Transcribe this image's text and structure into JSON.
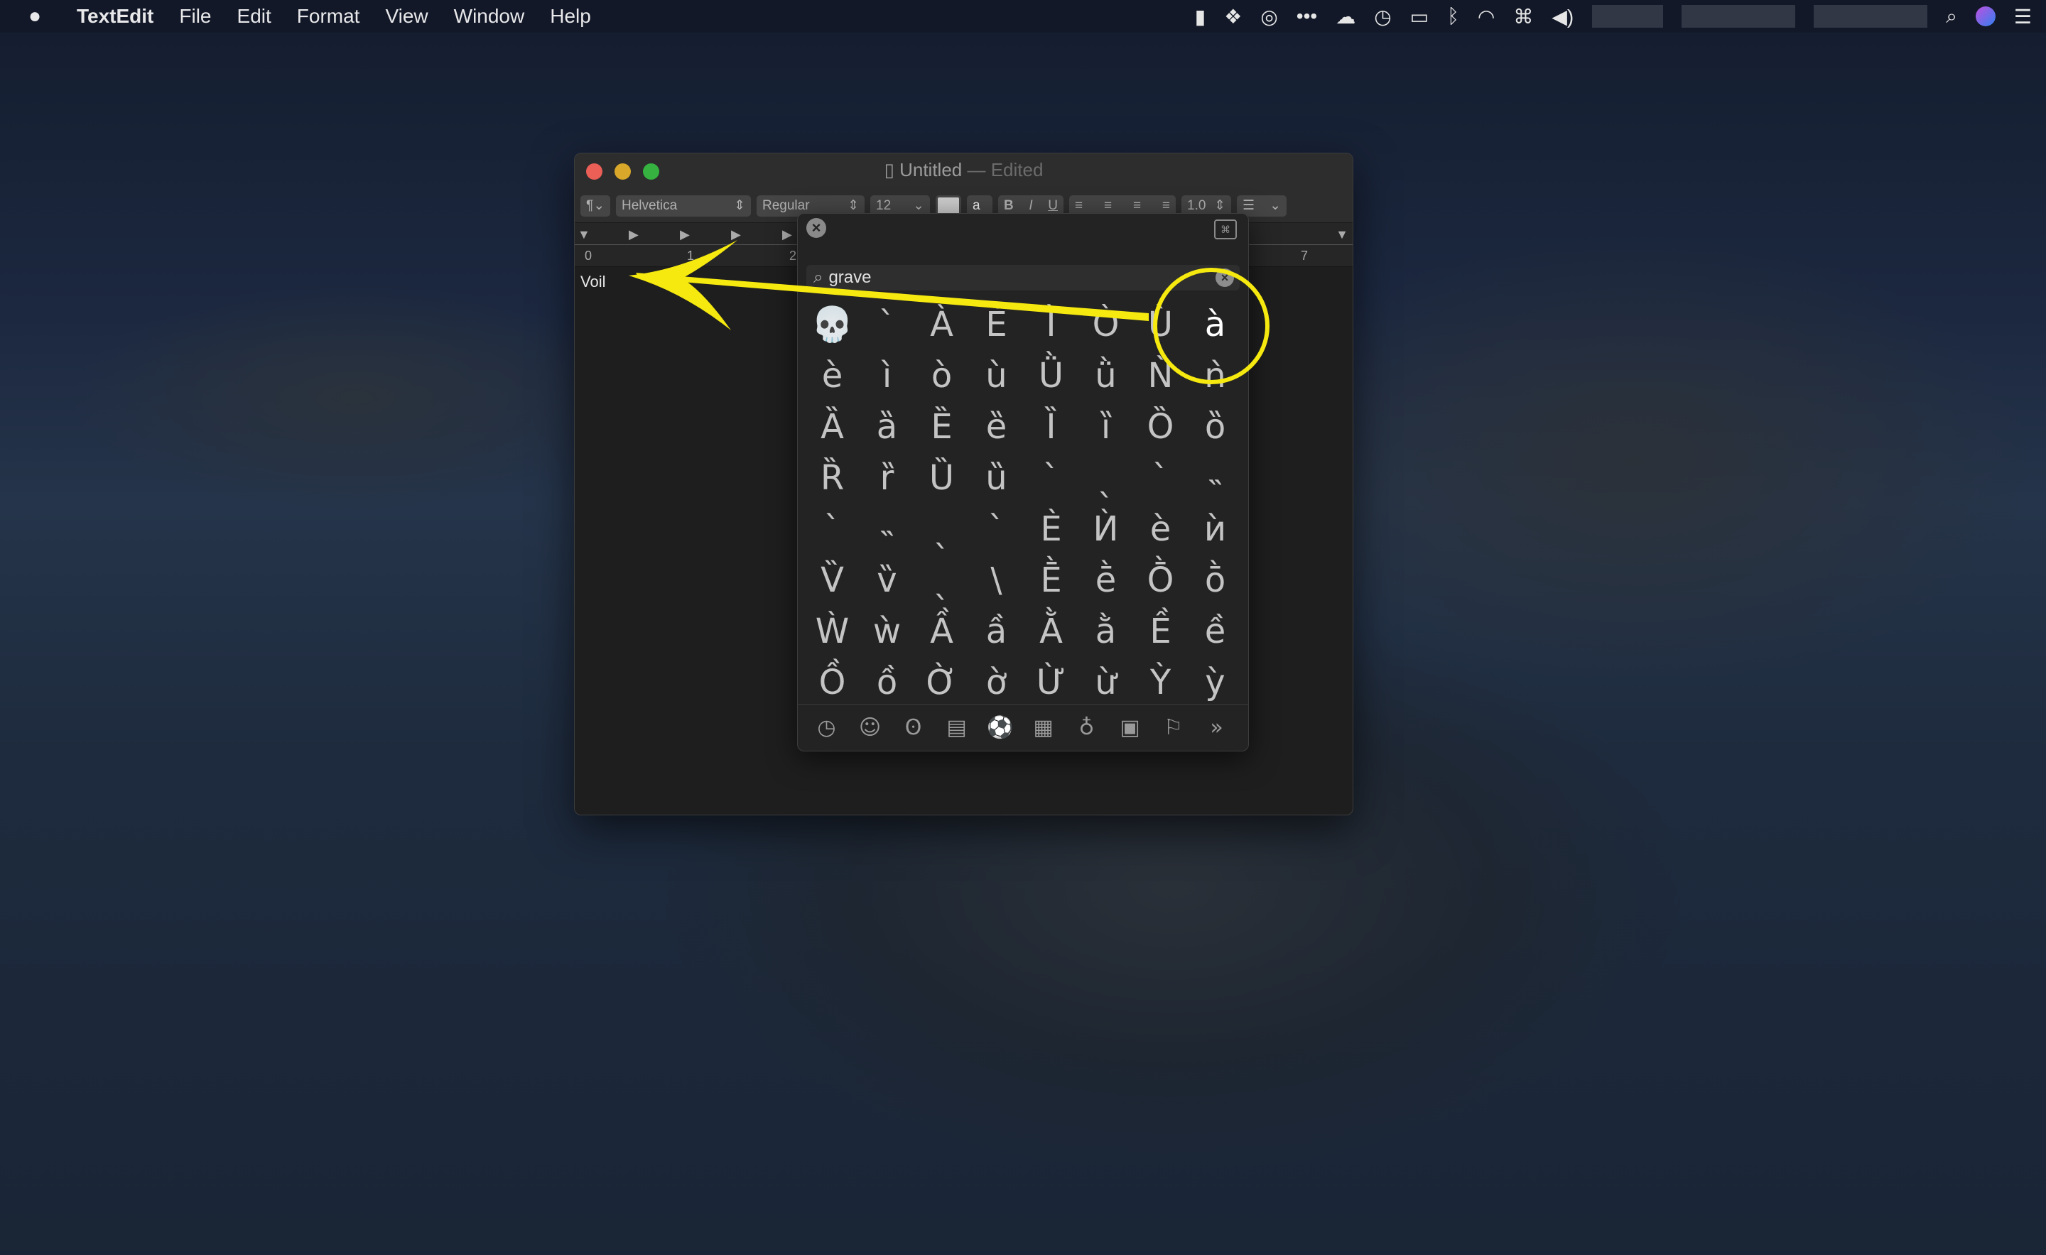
{
  "menubar": {
    "app": "TextEdit",
    "items": [
      "File",
      "Edit",
      "Format",
      "View",
      "Window",
      "Help"
    ]
  },
  "window": {
    "title": "Untitled",
    "title_suffix": "— Edited"
  },
  "toolbar": {
    "paragraph": "¶",
    "font": "Helvetica",
    "style": "Regular",
    "size": "12",
    "bold": "B",
    "italic": "I",
    "underline": "U",
    "spacing": "1.0"
  },
  "ruler": {
    "labels": [
      "0",
      "1",
      "2",
      "7"
    ]
  },
  "document": {
    "text": "Voil"
  },
  "viewer": {
    "search_value": "grave",
    "characters": [
      "💀",
      "`",
      "À",
      "È",
      "Ì",
      "Ò",
      "Ù",
      "à",
      "è",
      "ì",
      "ò",
      "ù",
      "Ǜ",
      "ǜ",
      "Ǹ",
      "ǹ",
      "Ȁ",
      "ȁ",
      "Ȅ",
      "ȅ",
      "Ȉ",
      "ȉ",
      "Ȍ",
      "ȍ",
      "Ȑ",
      "ȑ",
      "Ȕ",
      "ȕ",
      "ˋ",
      "ˎ",
      "ˋ",
      "˵",
      "ˋ",
      "˵",
      "ˎ",
      "ˋ",
      "Ѐ",
      "Ѝ",
      "ѐ",
      "ѝ",
      "V̏",
      "v̏",
      "ˎ",
      "\\",
      "Ḕ",
      "ḕ",
      "Ṑ",
      "ṑ",
      "Ẁ",
      "ẁ",
      "Ầ",
      "ầ",
      "Ằ",
      "ằ",
      "Ề",
      "ề",
      "Ồ",
      "ồ",
      "Ờ",
      "ờ",
      "Ừ",
      "ừ",
      "Ỳ",
      "ỳ"
    ],
    "selected": "à",
    "categories": [
      "recent-icon",
      "smileys-icon",
      "animals-icon",
      "food-icon",
      "activity-icon",
      "travel-icon",
      "objects-icon",
      "symbols-icon",
      "flags-icon",
      "more-icon"
    ]
  },
  "annotation": {
    "color": "#f5e90f"
  }
}
